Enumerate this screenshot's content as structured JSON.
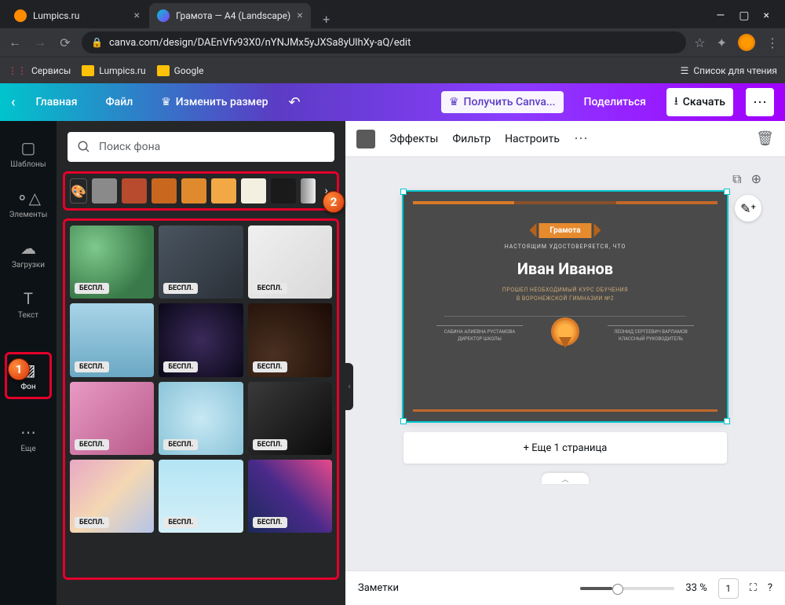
{
  "browser": {
    "tabs": [
      {
        "title": "Lumpics.ru",
        "favicon": "#ff8c00"
      },
      {
        "title": "Грамота — A4 (Landscape)",
        "favicon": "#00c4cc"
      }
    ],
    "url": "canva.com/design/DAEnVfv93X0/nYNJMx5yJXSa8yUlhXy-aQ/edit",
    "bookmarks": {
      "services": "Сервисы",
      "lumpics": "Lumpics.ru",
      "google": "Google",
      "readlist": "Список для чтения"
    }
  },
  "header": {
    "home": "Главная",
    "file": "Файл",
    "resize": "Изменить размер",
    "upgrade": "Получить Canva...",
    "share": "Поделиться",
    "download": "Скачать"
  },
  "rail": {
    "templates": "Шаблоны",
    "elements": "Элементы",
    "uploads": "Загрузки",
    "text": "Текст",
    "background": "Фон",
    "more": "Еще"
  },
  "panel": {
    "search_placeholder": "Поиск фона",
    "colors": [
      "#8a8a8a",
      "#b84a2e",
      "#c9671f",
      "#e08a2e",
      "#f2a845",
      "#f4f0e1",
      "#1a1a1a"
    ],
    "badge": "БЕСПЛ.",
    "tiles": [
      "radial-gradient(circle at 30% 30%,#7dc98a,#3a7a4a 70%)",
      "linear-gradient(135deg,#4a5560,#2a3038)",
      "linear-gradient(135deg,#f0f0f0,#d8d8d8)",
      "linear-gradient(180deg,#a8d4e8,#6ba8c4)",
      "radial-gradient(circle at 50% 50%,#3a2a5a,#0a0818)",
      "radial-gradient(circle at 30% 70%,#4a3020,#1a0a05)",
      "linear-gradient(135deg,#e89ac4,#b85a8a)",
      "radial-gradient(circle at 50% 50%,#c8e8f4,#8ac4d8)",
      "linear-gradient(135deg,#3a3a3a,#0a0a0a)",
      "linear-gradient(135deg,#e8a8c4,#f4d8b4,#b4c4e8)",
      "linear-gradient(180deg,#b4e4f4,#d4f0f8)",
      "linear-gradient(45deg,#1a2a5a,#4a2a8a,#e84a8a)"
    ]
  },
  "toolbar": {
    "effects": "Эффекты",
    "filter": "Фильтр",
    "adjust": "Настроить"
  },
  "cert": {
    "ribbon": "Грамота",
    "sub1": "НАСТОЯЩИМ УДОСТОВЕРЯЕТСЯ, ЧТО",
    "name": "Иван Иванов",
    "sub2a": "ПРОШЕЛ НЕОБХОДИМЫЙ КУРС ОБУЧЕНИЯ",
    "sub2b": "В ВОРОНЕЖСКОЙ ГИМНАЗИИ №2",
    "sig1a": "САБИНА АЛИЕВНА РУСТАМОВА",
    "sig1b": "ДИРЕКТОР ШКОЛЫ",
    "sig2a": "ЛЕОНИД СЕРГЕЕВИЧ ВАРЛАМОВ",
    "sig2b": "КЛАССНЫЙ РУКОВОДИТЕЛЬ"
  },
  "stage": {
    "addpage": "+ Еще 1 страница"
  },
  "footer": {
    "notes": "Заметки",
    "zoom": "33 %",
    "page": "1"
  },
  "callouts": {
    "one": "1",
    "two": "2"
  }
}
